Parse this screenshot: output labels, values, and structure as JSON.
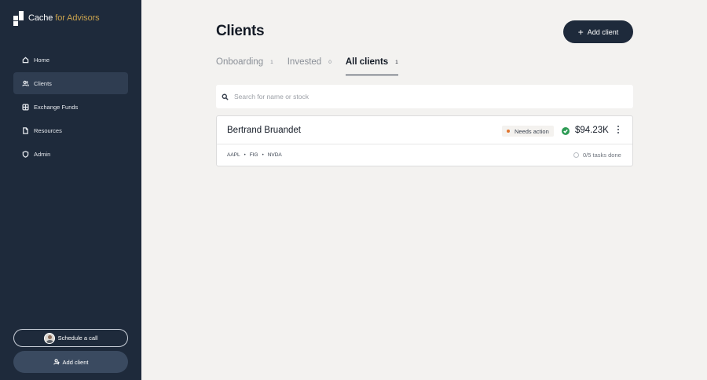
{
  "brand": {
    "name": "Cache",
    "suffix": "for Advisors"
  },
  "sidebar": {
    "items": [
      {
        "label": "Home",
        "icon": "home-icon"
      },
      {
        "label": "Clients",
        "icon": "users-icon",
        "active": true
      },
      {
        "label": "Exchange Funds",
        "icon": "globe-icon"
      },
      {
        "label": "Resources",
        "icon": "document-icon"
      },
      {
        "label": "Admin",
        "icon": "shield-icon"
      }
    ],
    "schedule_label": "Schedule a call",
    "add_client_label": "Add client"
  },
  "header": {
    "title": "Clients",
    "add_button_label": "Add client"
  },
  "tabs": [
    {
      "label": "Onboarding",
      "count": "1"
    },
    {
      "label": "Invested",
      "count": "0"
    },
    {
      "label": "All clients",
      "count": "1",
      "active": true
    }
  ],
  "search": {
    "placeholder": "Search for name or stock"
  },
  "clients": [
    {
      "name": "Bertrand Bruandet",
      "status": "Needs action",
      "amount": "$94.23K",
      "tickers": [
        "AAPL",
        "FIG",
        "NVDA"
      ],
      "tasks": "0/5 tasks done"
    }
  ],
  "colors": {
    "sidebar_bg": "#1e2a3b",
    "brand_accent": "#c9a24e",
    "status_dot": "#e0752f",
    "success": "#2e9b55"
  }
}
